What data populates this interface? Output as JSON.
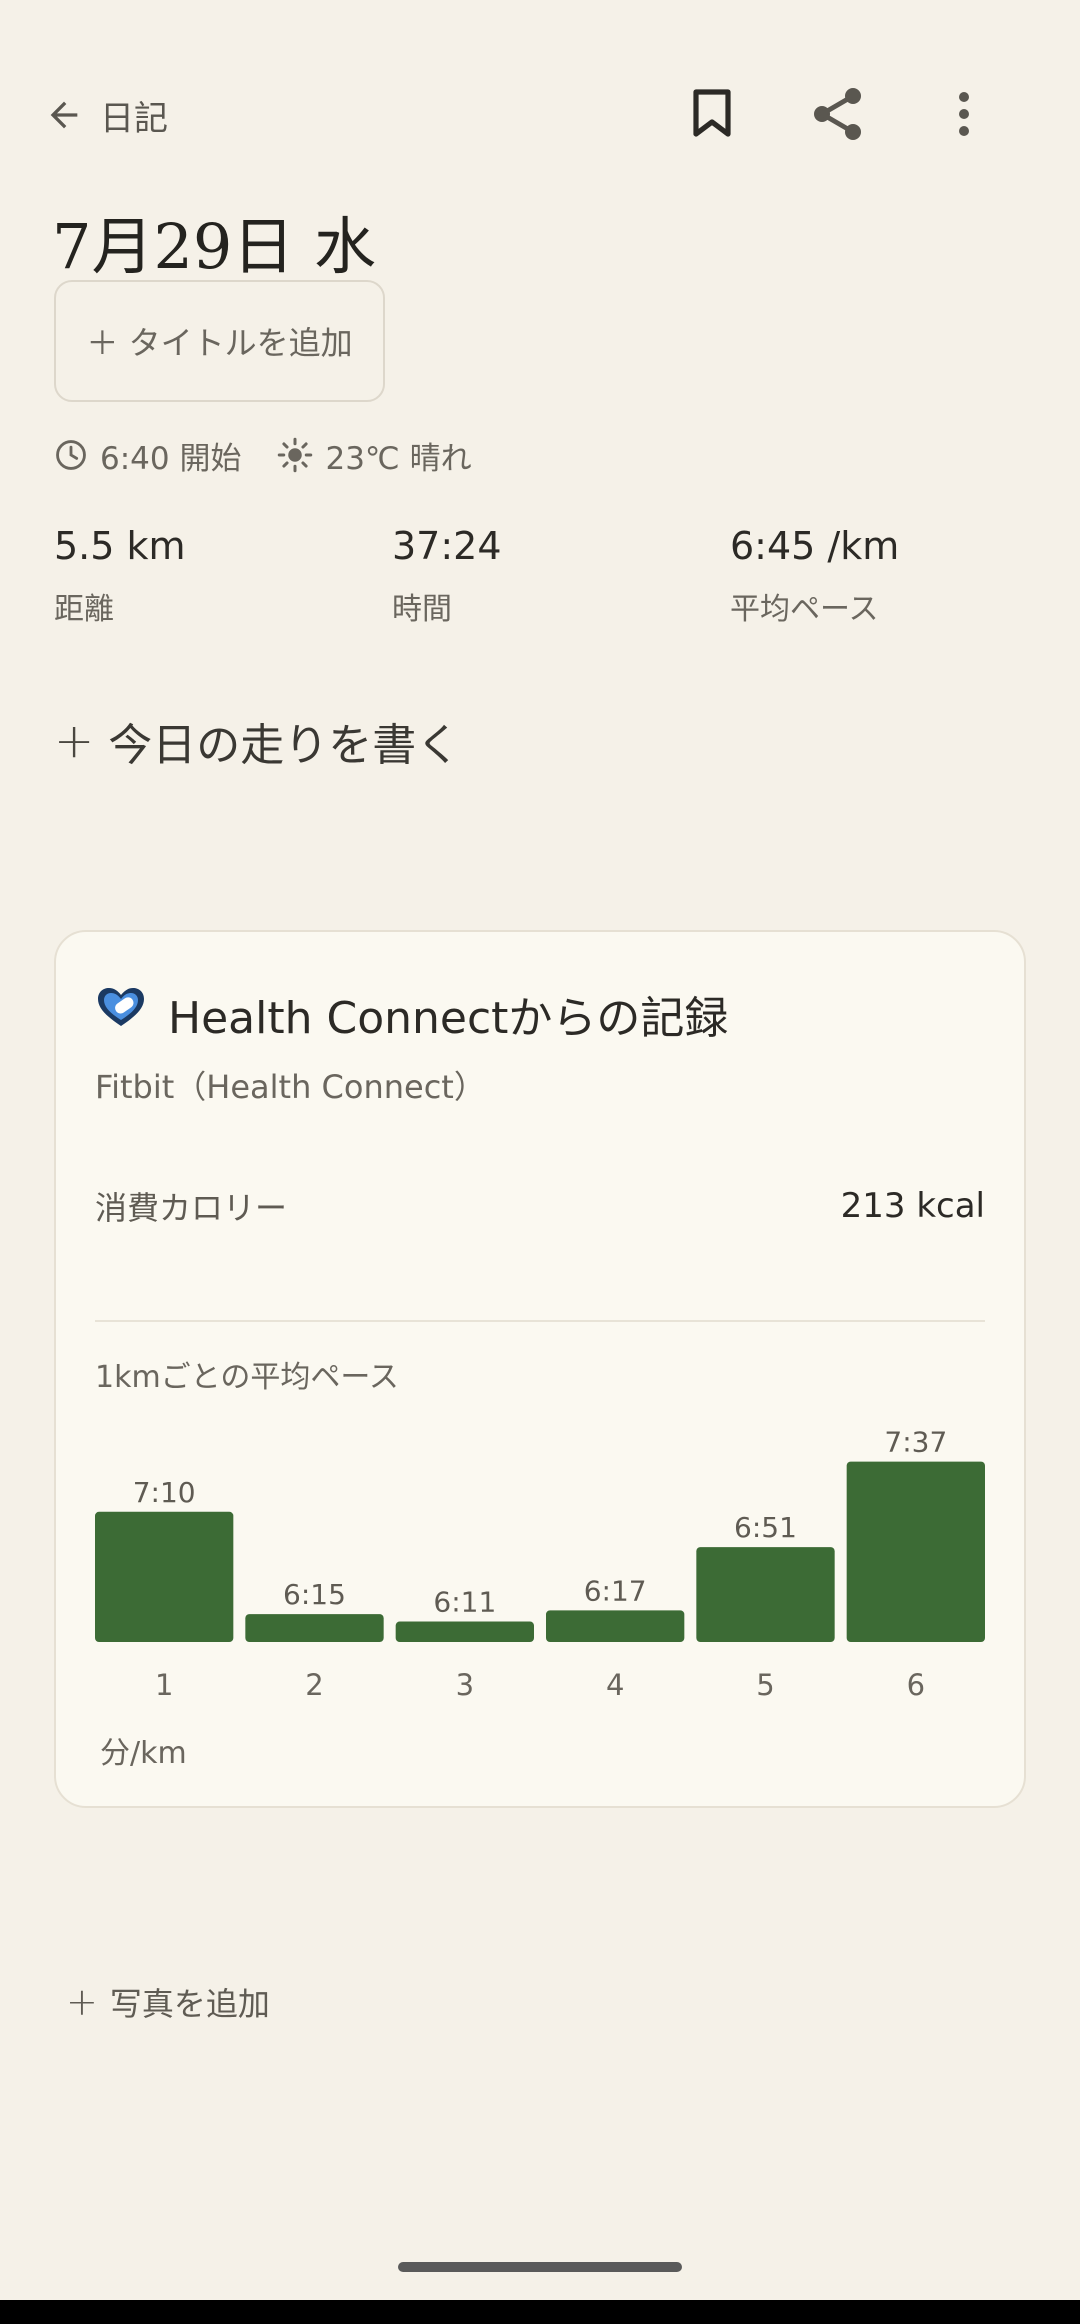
{
  "topbar": {
    "back_label": "日記"
  },
  "date_title": "7月29日 水",
  "add_title_button": "＋ タイトルを追加",
  "meta": {
    "start_time": "6:40 開始",
    "weather": "23℃ 晴れ"
  },
  "stats": [
    {
      "value": "5.5 km",
      "label": "距離"
    },
    {
      "value": "37:24",
      "label": "時間"
    },
    {
      "value": "6:45 /km",
      "label": "平均ペース"
    }
  ],
  "write_button": {
    "plus": "+",
    "text": "今日の走りを書く"
  },
  "card": {
    "title": "Health Connectからの記録",
    "source": "Fitbit（Health Connect）",
    "calories_label": "消費カロリー",
    "calories_value": "213 kcal",
    "pace_label": "1kmごとの平均ペース",
    "unit_label": "分/km"
  },
  "chart_data": {
    "type": "bar",
    "categories": [
      "1",
      "2",
      "3",
      "4",
      "5",
      "6"
    ],
    "values": [
      430,
      375,
      371,
      377,
      411,
      457
    ],
    "labels": [
      "7:10",
      "6:15",
      "6:11",
      "6:17",
      "6:51",
      "7:37"
    ],
    "baseline": 360,
    "color": "#3C6B35",
    "ylabel": "分/km"
  },
  "add_photo_button": {
    "plus": "+",
    "text": "写真を追加"
  }
}
